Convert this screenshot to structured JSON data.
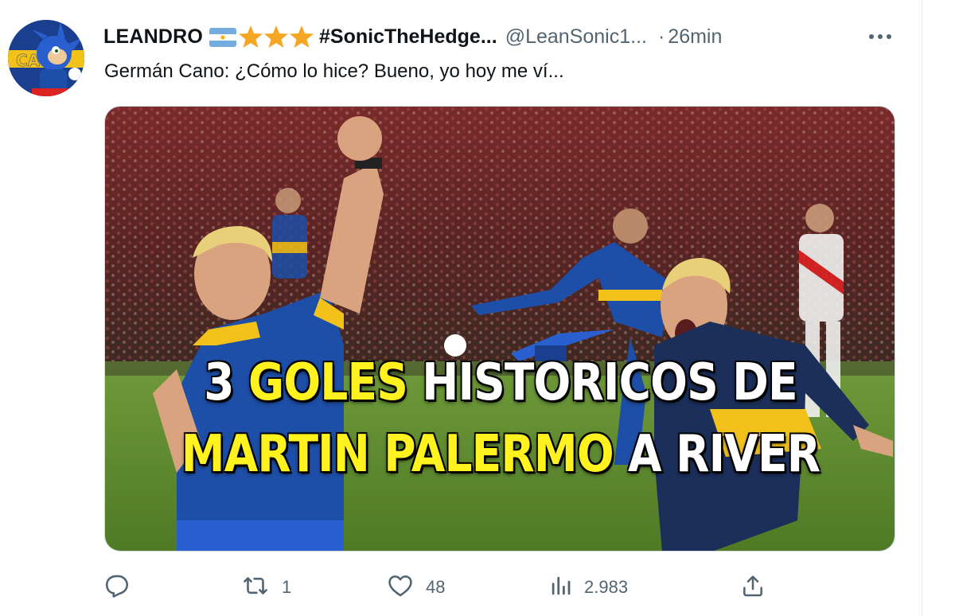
{
  "tweet": {
    "author_name": "LEANDRO",
    "name_suffix": "#SonicTheHedge...",
    "handle": "@LeanSonic1...",
    "separator": "·",
    "time": "26min",
    "text": "Germán Cano: ¿Cómo lo hice? Bueno, yo hoy me ví...",
    "emoji_icons": [
      "argentina-flag-icon",
      "star-icon",
      "star-icon",
      "star-icon"
    ],
    "avatar_badge_text": "CA"
  },
  "media": {
    "line1_part1": "3",
    "line1_part2": "GOLES",
    "line1_part3": "HISTORICOS DE",
    "line2_part1": "MARTIN PALERMO",
    "line2_part2": "A RIVER",
    "colors": {
      "white_text": "#ffffff",
      "yellow_text": "#fff21e",
      "pitch_green": "#5f8a2e",
      "crowd": "#6b2a2a",
      "boca_blue": "#1d4fa8",
      "boca_yellow": "#f2c21a"
    }
  },
  "actions": {
    "reply": {
      "icon": "reply-icon",
      "count": ""
    },
    "retweet": {
      "icon": "retweet-icon",
      "count": "1"
    },
    "like": {
      "icon": "heart-icon",
      "count": "48"
    },
    "views": {
      "icon": "views-icon",
      "count": "2.983"
    },
    "share": {
      "icon": "share-icon",
      "count": ""
    }
  },
  "colors": {
    "text_primary": "#0f1419",
    "text_secondary": "#536471",
    "star": "#f5a623"
  }
}
